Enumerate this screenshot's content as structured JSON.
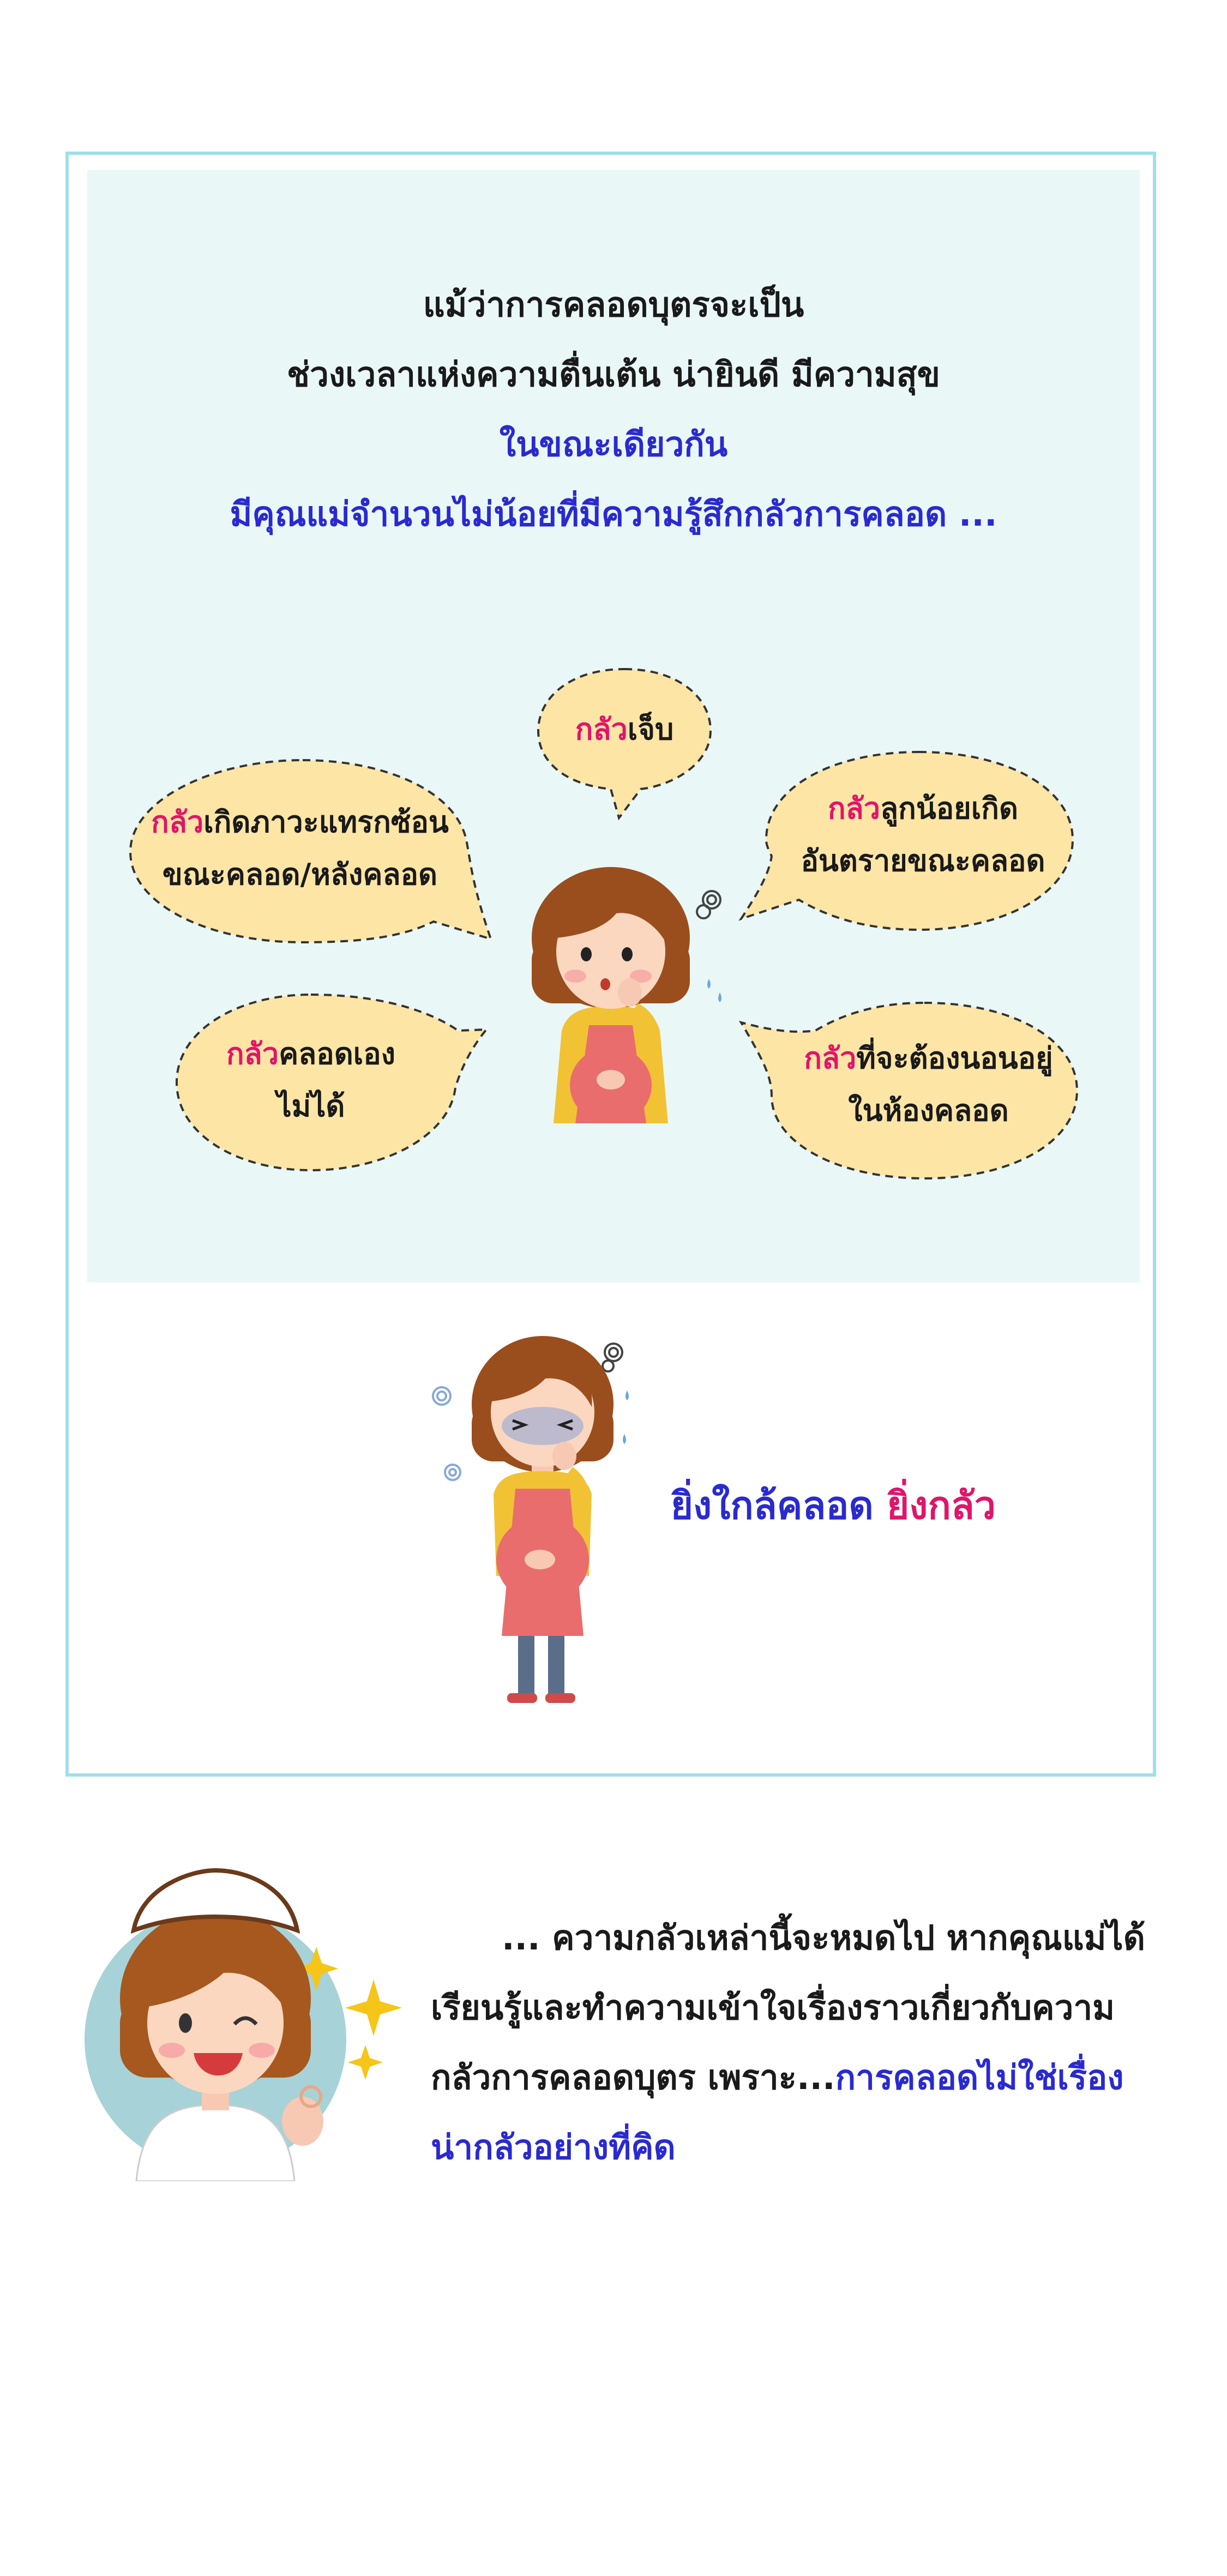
{
  "intro": {
    "line1": "แม้ว่าการคลอดบุตรจะเป็น",
    "line2": "ช่วงเวลาแห่งความตื่นเต้น น่ายินดี มีความสุข",
    "line3": "ในขณะเดียวกัน",
    "line4": "มีคุณแม่จำนวนไม่น้อยที่มีความรู้สึกกลัวการคลอด ..."
  },
  "fears": {
    "fear_word": "กลัว",
    "pain": {
      "rest": "เจ็บ"
    },
    "complication": {
      "rest1": "เกิดภาวะแทรกซ้อน",
      "line2": "ขณะคลอด/หลังคลอด"
    },
    "baby_danger": {
      "rest1": "ลูกน้อยเกิด",
      "line2": "อันตรายขณะคลอด"
    },
    "self_delivery": {
      "rest1": "คลอดเอง",
      "line2": "ไม่ได้"
    },
    "lying_down": {
      "rest1": "ที่จะต้องนอนอยู่",
      "line2": "ในห้องคลอด"
    }
  },
  "closer": {
    "part1": "ยิ่งใกล้คลอด",
    "part2": "ยิ่งกลัว"
  },
  "nurse_message": {
    "line1": "... ความกลัวเหล่านี้จะหมดไป หากคุณแม่ได้",
    "line2": "เรียนรู้และทำความเข้าใจเรื่องราวเกี่ยวกับความ",
    "line3_plain": "กลัวการคลอดบุตร เพราะ...",
    "line3_highlight": "การคลอดไม่ใช่เรื่อง",
    "line4_highlight": "น่ากลัวอย่างที่คิด"
  },
  "colors": {
    "frame_border": "#9fdfe8",
    "panel_bg": "#e9f7f7",
    "bubble_fill": "#fde5a6",
    "accent_pink": "#e0156a",
    "accent_blue": "#2a2ad0"
  }
}
